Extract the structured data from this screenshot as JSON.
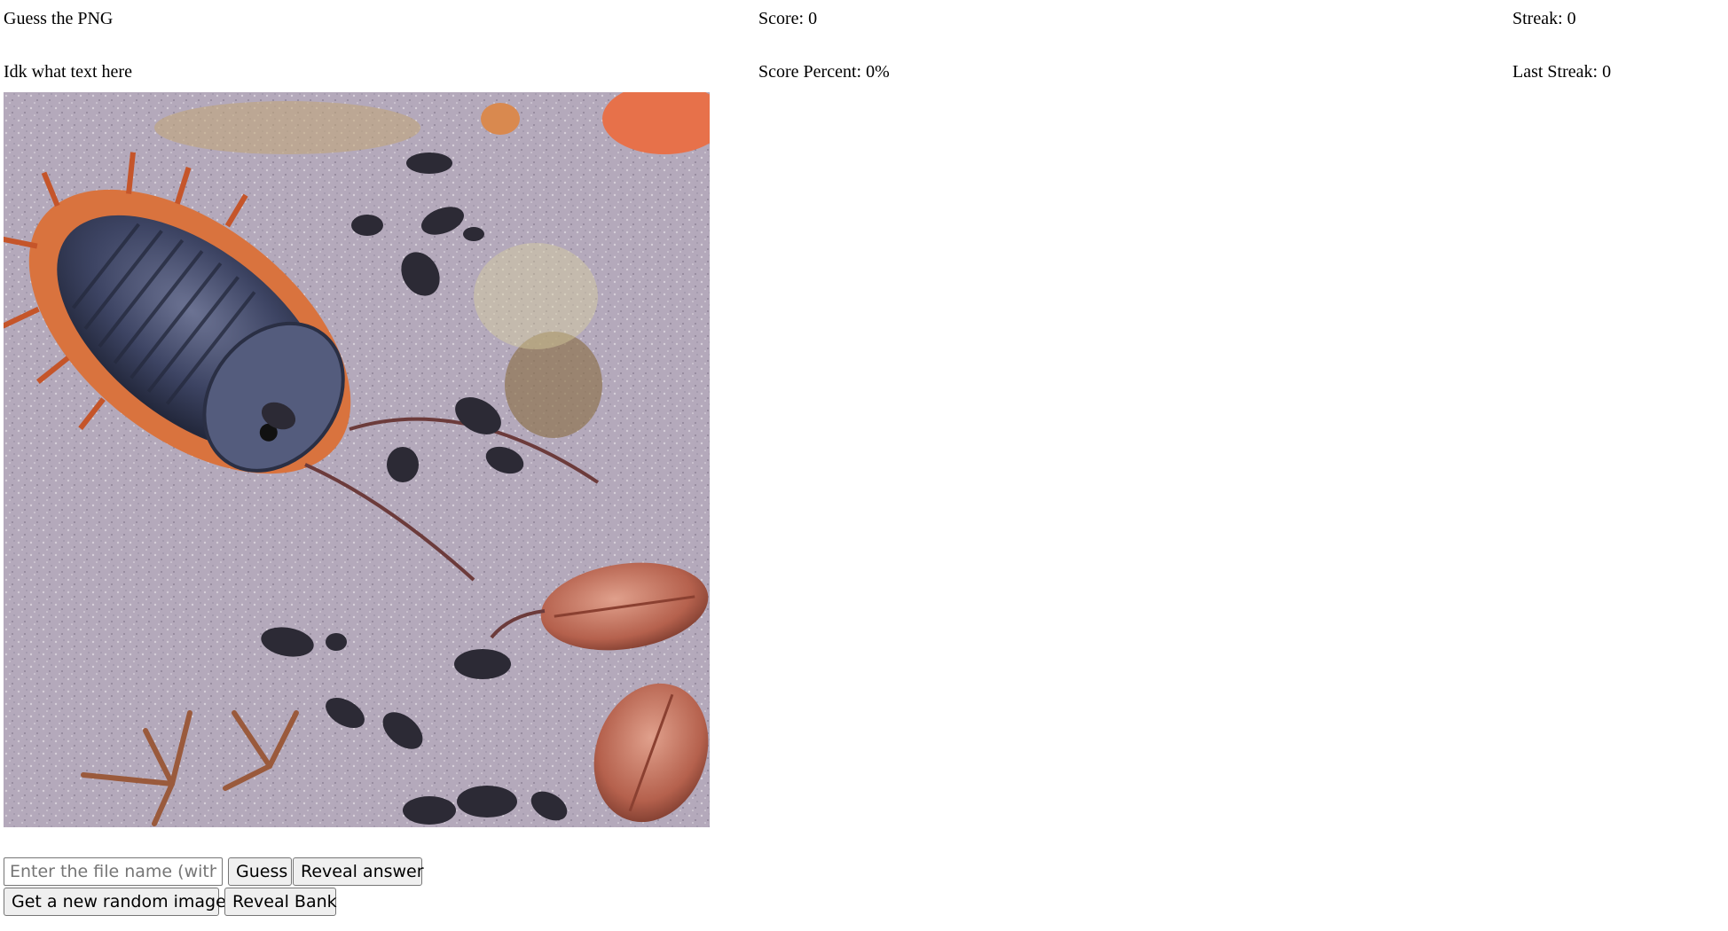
{
  "header": {
    "title": "Guess the PNG",
    "subtitle": "Idk what text here"
  },
  "stats": {
    "score": "Score: 0",
    "score_percent": "Score Percent: 0%",
    "streak": "Streak: 0",
    "last_streak": "Last Streak: 0"
  },
  "image": {
    "icon": "trilobite-photo"
  },
  "controls": {
    "guess_placeholder": "Enter the file name (without extension)",
    "guess_value": "",
    "guess_label": "Guess",
    "reveal_answer_label": "Reveal answer",
    "random_image_label": "Get a new random image",
    "reveal_bank_label": "Reveal Bank"
  }
}
